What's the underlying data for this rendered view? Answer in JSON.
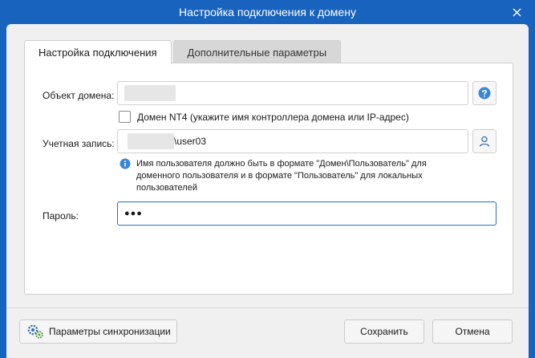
{
  "window": {
    "title": "Настройка подключения к домену",
    "close_icon": "close-icon"
  },
  "tabs": [
    {
      "label": "Настройка подключения",
      "active": true
    },
    {
      "label": "Дополнительные параметры",
      "active": false
    }
  ],
  "form": {
    "domain_object": {
      "label": "Объект домена:",
      "value": "",
      "help_icon": "question-icon"
    },
    "nt4_checkbox": {
      "label": "Домен NT4 (укажите имя контроллера домена или IP-адрес)",
      "checked": false
    },
    "account": {
      "label": "Учетная запись:",
      "value": "\\user03",
      "picker_icon": "user-icon"
    },
    "info_text": "Имя пользователя должно быть в формате \"Домен\\Пользователь\" для доменного пользователя и в формате \"Пользователь\" для локальных пользователей",
    "info_icon": "info-icon",
    "password": {
      "label": "Пароль:",
      "value": "●●●"
    }
  },
  "footer": {
    "sync_button": "Параметры синхронизации",
    "sync_icon": "gears-icon",
    "save_button": "Сохранить",
    "cancel_button": "Отмена"
  },
  "colors": {
    "titlebar": "#1863bd",
    "dialog_bg": "#f0f0f0",
    "focus_border": "#1f6fd1",
    "info_blue": "#3a86d4"
  }
}
